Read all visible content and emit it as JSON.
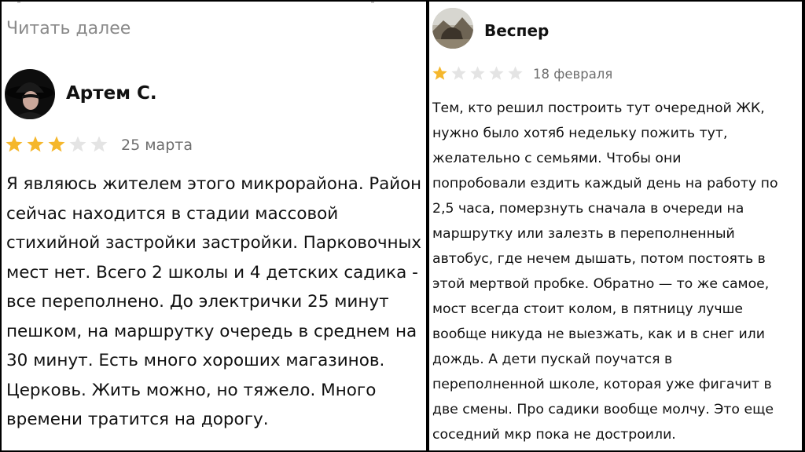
{
  "left_review": {
    "read_more": "Читать далее",
    "author": "Артем С.",
    "rating": 3,
    "max_rating": 5,
    "date": "25 марта",
    "lines": [
      "Я являюсь жителем этого микрорайона. Район",
      "сейчас находится в стадии массовой",
      "стихийной застройки застройки. Парковочных",
      "мест нет. Всего 2 школы и 4 детских садика -",
      "все переполнено. До электрички 25 минут",
      "пешком, на маршрутку очередь в среднем на",
      "30 минут. Есть много хороших магазинов.",
      "Церковь. Жить можно, но тяжело. Много",
      "времени тратится на дорогу."
    ]
  },
  "right_review": {
    "author": "Веспер",
    "rating": 1,
    "max_rating": 5,
    "date": "18 февраля",
    "lines": [
      "Тем, кто решил построить тут очередной ЖК,",
      "нужно было хотяб недельку пожить тут,",
      "желательно с семьями. Чтобы они",
      "попробовали ездить каждый день на работу по",
      "2,5 часа, померзнуть сначала в очереди на",
      "маршрутку или залезть в переполненный",
      "автобус, где нечем дышать, потом постоять в",
      "этой мертвой пробке. Обратно — то же самое,",
      "мост всегда стоит колом, в пятницу лучше",
      "вообще никуда не выезжать, как и в снег или",
      "дождь. А дети пускай поучатся в",
      "переполненной школе, которая уже фигачит в",
      "две смены. Про садики вообще молчу. Это еще",
      "соседний мкр пока не достроили."
    ]
  },
  "colors": {
    "star_filled": "#f5b72c",
    "star_empty": "#e4e4e4",
    "date": "#6e6e6e",
    "read_more": "#8a8a8a",
    "divider": "#000000"
  },
  "icons": {
    "star": "star-icon",
    "avatar_left": "avatar-photo",
    "avatar_right": "avatar-photo"
  }
}
